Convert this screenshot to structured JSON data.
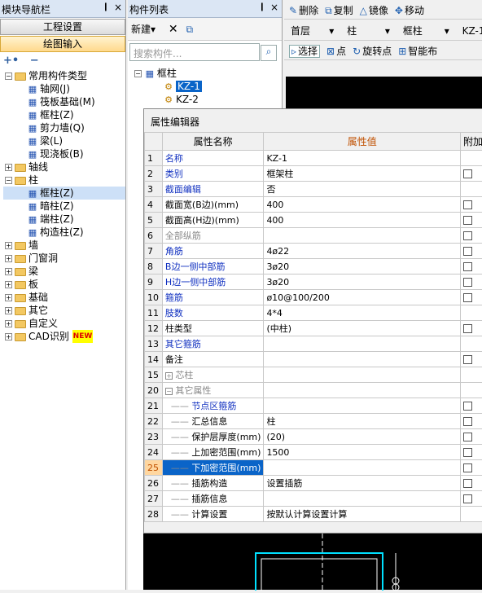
{
  "left_panel": {
    "title": "模块导航栏",
    "pin": "❙",
    "close": "×",
    "nav_buttons": [
      "工程设置",
      "绘图输入"
    ],
    "expand_all": "+•",
    "collapse_all": "−",
    "tree": [
      {
        "label": "常用构件类型",
        "level": 0,
        "toggle": "−",
        "folder": true
      },
      {
        "label": "轴网(J)",
        "level": 1,
        "icon": "grid-icon"
      },
      {
        "label": "筏板基础(M)",
        "level": 1,
        "icon": "raft-icon"
      },
      {
        "label": "框柱(Z)",
        "level": 1,
        "icon": "column-icon"
      },
      {
        "label": "剪力墙(Q)",
        "level": 1,
        "icon": "wall-icon"
      },
      {
        "label": "梁(L)",
        "level": 1,
        "icon": "beam-icon"
      },
      {
        "label": "现浇板(B)",
        "level": 1,
        "icon": "slab-icon"
      },
      {
        "label": "轴线",
        "level": 0,
        "toggle": "+",
        "folder": true
      },
      {
        "label": "柱",
        "level": 0,
        "toggle": "−",
        "folder": true
      },
      {
        "label": "框柱(Z)",
        "level": 1,
        "icon": "column-icon",
        "selected": true
      },
      {
        "label": "暗柱(Z)",
        "level": 1,
        "icon": "column-icon"
      },
      {
        "label": "端柱(Z)",
        "level": 1,
        "icon": "column-icon"
      },
      {
        "label": "构造柱(Z)",
        "level": 1,
        "icon": "column-icon"
      },
      {
        "label": "墙",
        "level": 0,
        "toggle": "+",
        "folder": true
      },
      {
        "label": "门窗洞",
        "level": 0,
        "toggle": "+",
        "folder": true
      },
      {
        "label": "梁",
        "level": 0,
        "toggle": "+",
        "folder": true
      },
      {
        "label": "板",
        "level": 0,
        "toggle": "+",
        "folder": true
      },
      {
        "label": "基础",
        "level": 0,
        "toggle": "+",
        "folder": true
      },
      {
        "label": "其它",
        "level": 0,
        "toggle": "+",
        "folder": true
      },
      {
        "label": "自定义",
        "level": 0,
        "toggle": "+",
        "folder": true
      },
      {
        "label": "CAD识别",
        "level": 0,
        "toggle": "+",
        "folder": true,
        "badge": "NEW"
      }
    ]
  },
  "mid_panel": {
    "title": "构件列表",
    "pin": "❙",
    "close": "×",
    "new_label": "新建",
    "new_arrow": "▾",
    "delete_glyph": "✕",
    "copy_glyph": "⧉",
    "search_placeholder": "搜索构件...",
    "search_glyph": "⌕",
    "tree": [
      {
        "label": "框柱",
        "level": 0,
        "toggle": "−"
      },
      {
        "label": "KZ-1",
        "level": 1,
        "selected": true
      },
      {
        "label": "KZ-2",
        "level": 1
      }
    ]
  },
  "right_toolbar": {
    "row1": [
      "删除",
      "复制",
      "镜像",
      "移动"
    ],
    "row1_icons": [
      "✎",
      "⧉",
      "△",
      "✥"
    ],
    "floor": "首层",
    "type": "柱",
    "subtype": "框柱",
    "element": "KZ-1",
    "row3": [
      "选择",
      "点",
      "旋转点",
      "智能布"
    ],
    "row3_icons": [
      "▹",
      "⊠",
      "↻",
      "⊞"
    ]
  },
  "property_editor": {
    "title": "属性编辑器",
    "columns": [
      "属性名称",
      "属性值",
      "附加"
    ],
    "rows": [
      {
        "num": "1",
        "name": "名称",
        "value": "KZ-1",
        "style": "blue",
        "check": false,
        "tree": ""
      },
      {
        "num": "2",
        "name": "类别",
        "value": "框架柱",
        "style": "blue",
        "check": true,
        "tree": ""
      },
      {
        "num": "3",
        "name": "截面编辑",
        "value": "否",
        "style": "blue",
        "check": false,
        "tree": ""
      },
      {
        "num": "4",
        "name": "截面宽(B边)(mm)",
        "value": "400",
        "style": "",
        "check": true,
        "tree": ""
      },
      {
        "num": "5",
        "name": "截面高(H边)(mm)",
        "value": "400",
        "style": "",
        "check": true,
        "tree": ""
      },
      {
        "num": "6",
        "name": "全部纵筋",
        "value": "",
        "style": "gray",
        "check": true,
        "tree": ""
      },
      {
        "num": "7",
        "name": "角筋",
        "value": "4ø22",
        "style": "blue",
        "check": true,
        "tree": ""
      },
      {
        "num": "8",
        "name": "B边一侧中部筋",
        "value": "3ø20",
        "style": "blue",
        "check": true,
        "tree": ""
      },
      {
        "num": "9",
        "name": "H边一侧中部筋",
        "value": "3ø20",
        "style": "blue",
        "check": true,
        "tree": ""
      },
      {
        "num": "10",
        "name": "箍筋",
        "value": "ø10@100/200",
        "style": "blue",
        "check": true,
        "tree": ""
      },
      {
        "num": "11",
        "name": "肢数",
        "value": "4*4",
        "style": "blue",
        "check": false,
        "tree": ""
      },
      {
        "num": "12",
        "name": "柱类型",
        "value": "(中柱)",
        "style": "",
        "check": true,
        "tree": ""
      },
      {
        "num": "13",
        "name": "其它箍筋",
        "value": "",
        "style": "blue",
        "check": false,
        "tree": ""
      },
      {
        "num": "14",
        "name": "备注",
        "value": "",
        "style": "",
        "check": true,
        "tree": ""
      },
      {
        "num": "15",
        "name": "芯柱",
        "value": "",
        "style": "gray",
        "check": false,
        "tree": "+"
      },
      {
        "num": "20",
        "name": "其它属性",
        "value": "",
        "style": "gray",
        "check": false,
        "tree": "−"
      },
      {
        "num": "21",
        "name": "节点区箍筋",
        "value": "",
        "style": "blue",
        "check": true,
        "tree": "child"
      },
      {
        "num": "22",
        "name": "汇总信息",
        "value": "柱",
        "style": "",
        "check": true,
        "tree": "child"
      },
      {
        "num": "23",
        "name": "保护层厚度(mm)",
        "value": "(20)",
        "style": "",
        "check": true,
        "tree": "child"
      },
      {
        "num": "24",
        "name": "上加密范围(mm)",
        "value": "1500",
        "style": "",
        "check": true,
        "tree": "child"
      },
      {
        "num": "25",
        "name": "下加密范围(mm)",
        "value": "",
        "style": "",
        "check": true,
        "tree": "child",
        "active": true
      },
      {
        "num": "26",
        "name": "插筋构造",
        "value": "设置插筋",
        "style": "",
        "check": true,
        "tree": "child"
      },
      {
        "num": "27",
        "name": "插筋信息",
        "value": "",
        "style": "",
        "check": true,
        "tree": "child"
      },
      {
        "num": "28",
        "name": "计算设置",
        "value": "按默认计算设置计算",
        "style": "",
        "check": false,
        "tree": "child"
      }
    ]
  }
}
